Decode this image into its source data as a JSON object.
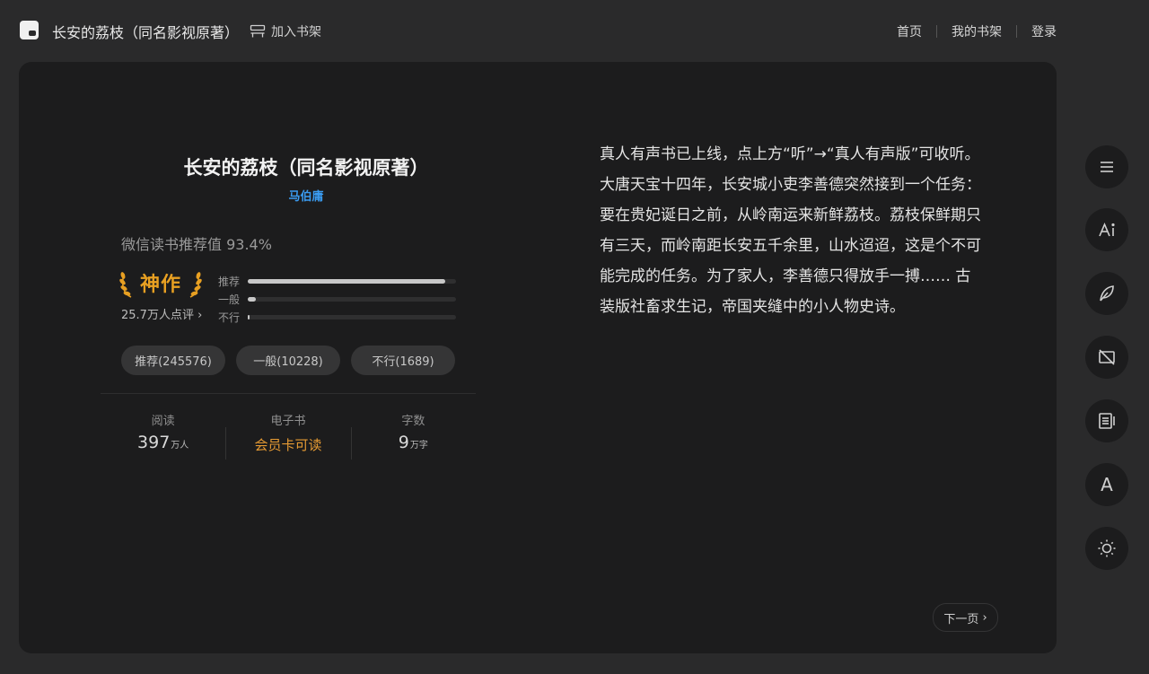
{
  "header": {
    "book_title": "长安的荔枝（同名影视原著）",
    "add_to_shelf": "加入书架",
    "nav": [
      "首页",
      "我的书架",
      "登录"
    ]
  },
  "book": {
    "title": "长安的荔枝（同名影视原著）",
    "author": "马伯庸",
    "recommend_value": "微信读书推荐值 93.4%",
    "badge": "神作",
    "review_count": "25.7万人点评",
    "rating_bars": [
      {
        "label": "推荐",
        "fraction": 0.95
      },
      {
        "label": "一般",
        "fraction": 0.04
      },
      {
        "label": "不行",
        "fraction": 0.007
      }
    ],
    "votes": [
      "推荐(245576)",
      "一般(10228)",
      "不行(1689)"
    ],
    "stats": {
      "read_label": "阅读",
      "read_value": "397",
      "read_unit": "万人",
      "ebook_label": "电子书",
      "ebook_value": "会员卡可读",
      "words_label": "字数",
      "words_value": "9",
      "words_unit": "万字"
    },
    "intro": "真人有声书已上线，点上方“听”→“真人有声版”可收听。 大唐天宝十四年，长安城小吏李善德突然接到一个任务：要在贵妃诞日之前，从岭南运来新鲜荔枝。荔枝保鲜期只有三天，而岭南距长安五千余里，山水迢迢，这是个不可能完成的任务。为了家人，李善德只得放手一搏…… 古装版社畜求生记，帝国夹缝中的小人物史诗。",
    "next_page": "下一页"
  },
  "toolbar": {
    "icons": [
      "catalog-icon",
      "ai-icon",
      "note-icon",
      "hide-icon",
      "text-icon",
      "font-icon",
      "brightness-icon"
    ],
    "font_glyph": "A"
  },
  "colors": {
    "background": "#2a2a2b",
    "card": "#1c1c1d",
    "author": "#3a9bf0",
    "accent": "#e59a33",
    "badge": "#e8a022"
  }
}
